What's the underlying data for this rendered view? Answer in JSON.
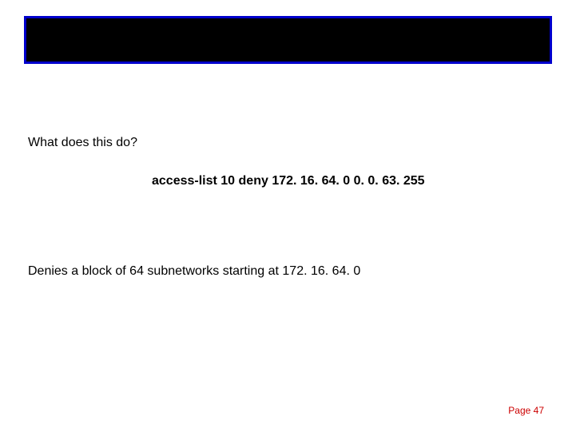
{
  "question": "What does this do?",
  "command": "access-list 10 deny 172. 16. 64. 0  0. 0. 63. 255",
  "answer": "Denies a block of 64 subnetworks starting at 172. 16. 64. 0",
  "footer": "Page 47"
}
